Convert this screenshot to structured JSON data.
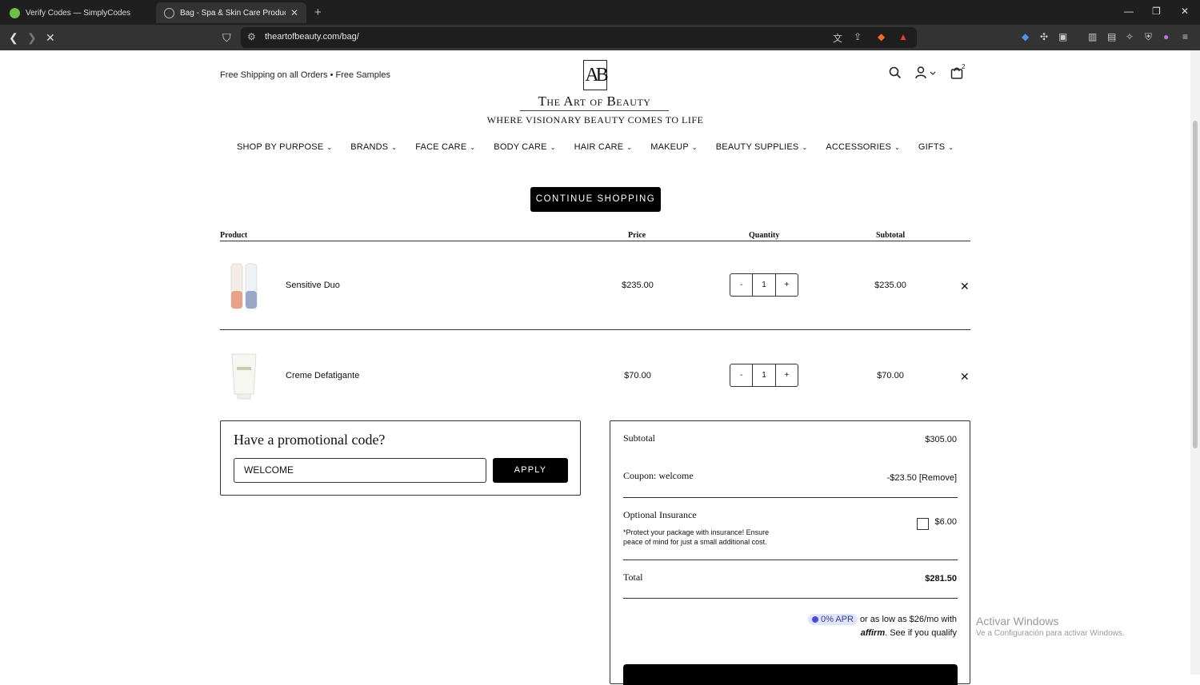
{
  "browser": {
    "tabs": [
      {
        "label": "Verify Codes — SimplyCodes"
      },
      {
        "label": "Bag - Spa & Skin Care Products |"
      }
    ],
    "new_tab": "+",
    "url": "theartofbeauty.com/bag/"
  },
  "header": {
    "promo_text": "Free Shipping on all Orders • Free Samples",
    "logo_mark": "AB",
    "logo_name": "The Art of Beauty",
    "logo_tagline": "Where Visionary Beauty Comes to Life",
    "cart_count": "2"
  },
  "nav": {
    "items": [
      {
        "label": "SHOP BY PURPOSE"
      },
      {
        "label": "BRANDS"
      },
      {
        "label": "FACE CARE"
      },
      {
        "label": "BODY CARE"
      },
      {
        "label": "HAIR CARE"
      },
      {
        "label": "MAKEUP"
      },
      {
        "label": "BEAUTY SUPPLIES"
      },
      {
        "label": "ACCESSORIES"
      },
      {
        "label": "GIFTS"
      }
    ]
  },
  "cart": {
    "continue_label": "CONTINUE SHOPPING",
    "columns": {
      "product": "Product",
      "price": "Price",
      "quantity": "Quantity",
      "subtotal": "Subtotal"
    },
    "items": [
      {
        "name": "Sensitive Duo",
        "price": "$235.00",
        "qty": "1",
        "subtotal": "$235.00"
      },
      {
        "name": "Creme Defatigante",
        "price": "$70.00",
        "qty": "1",
        "subtotal": "$70.00"
      }
    ],
    "minus": "-",
    "plus": "+",
    "remove": "✕"
  },
  "promo": {
    "title": "Have a promotional code?",
    "input_value": "WELCOME",
    "apply_label": "APPLY"
  },
  "summary": {
    "subtotal_label": "Subtotal",
    "subtotal_value": "$305.00",
    "coupon_label": "Coupon: welcome",
    "coupon_value": "-$23.50 [Remove]",
    "insurance_label": "Optional Insurance",
    "insurance_note": "*Protect your package with insurance! Ensure peace of mind for just a small additional cost.",
    "insurance_value": "$6.00",
    "total_label": "Total",
    "total_value": "$281.50",
    "apr_badge": "0% APR",
    "affirm_text1": "or as low as $26/mo with",
    "affirm_logo": "affirm",
    "affirm_text2": ". See if you qualify"
  },
  "watermark": {
    "line1": "Activar Windows",
    "line2": "Ve a Configuración para activar Windows."
  }
}
